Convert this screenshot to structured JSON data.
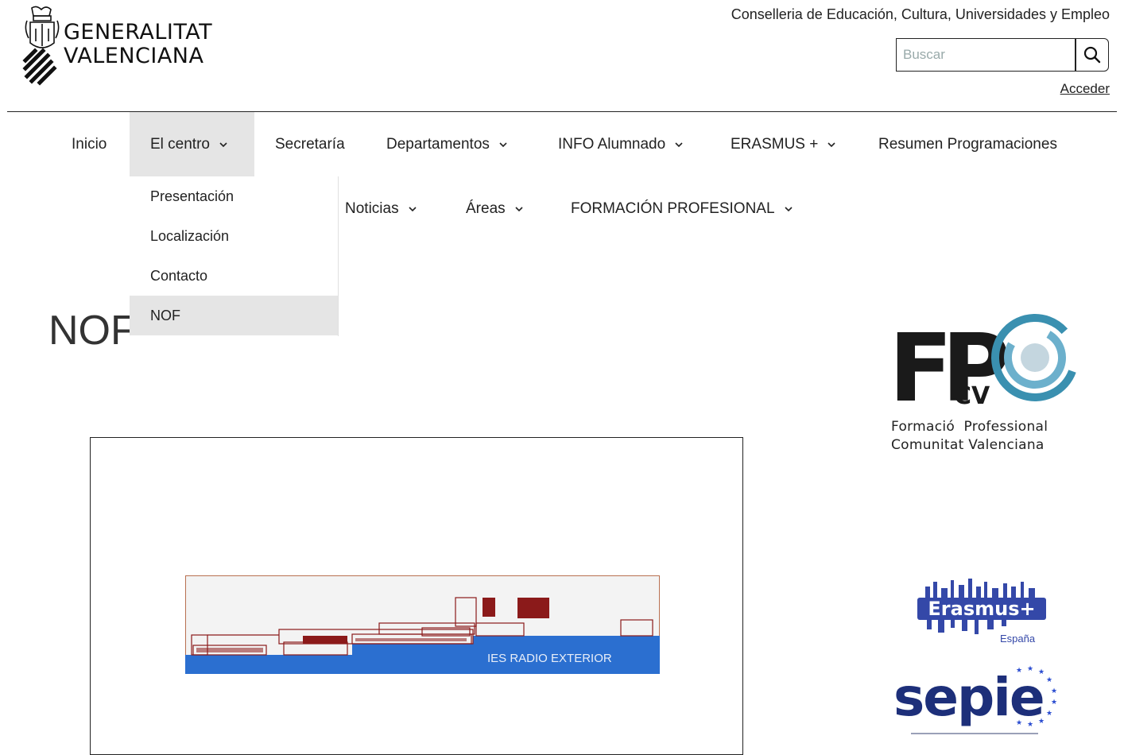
{
  "header": {
    "logo_line1": "GENERALITAT",
    "logo_line2": "VALENCIANA",
    "conselleria": "Conselleria de Educación, Cultura, Universidades y Empleo",
    "search_placeholder": "Buscar",
    "login_label": "Acceder"
  },
  "nav": {
    "items": [
      {
        "label": "Inicio",
        "has_dropdown": false
      },
      {
        "label": "El centro",
        "has_dropdown": true,
        "active": true
      },
      {
        "label": "Secretaría",
        "has_dropdown": false
      },
      {
        "label": "Departamentos",
        "has_dropdown": true
      },
      {
        "label": "INFO Alumnado",
        "has_dropdown": true
      },
      {
        "label": "ERASMUS +",
        "has_dropdown": true
      },
      {
        "label": "Resumen Programaciones",
        "has_dropdown": false
      },
      {
        "label": "Noticias",
        "has_dropdown": true
      },
      {
        "label": "Áreas",
        "has_dropdown": true
      },
      {
        "label": "FORMACIÓN PROFESIONAL",
        "has_dropdown": true
      }
    ],
    "dropdown": [
      {
        "label": "Presentación"
      },
      {
        "label": "Localización"
      },
      {
        "label": "Contacto"
      },
      {
        "label": "NOF",
        "active": true
      }
    ]
  },
  "main": {
    "page_title": "NOF",
    "building_caption": "IES RADIO EXTERIOR"
  },
  "sidebar": {
    "fpcv_letters": "FP",
    "fpcv_sub": "CV",
    "fpcv_caption_line1": "Formació  Professional",
    "fpcv_caption_line2": "Comunitat Valenciana",
    "erasmus_text": "Erasmus+",
    "erasmus_country": "España",
    "sepie_text": "sepie"
  },
  "colors": {
    "active_bg": "#e5e5e5",
    "building_blue": "#2b6fd0",
    "building_brown": "#8b1a1a",
    "fpcv_blue": "#3a90b0",
    "sepie_navy": "#1d2f7a",
    "erasmus_blue": "#3448a8"
  }
}
